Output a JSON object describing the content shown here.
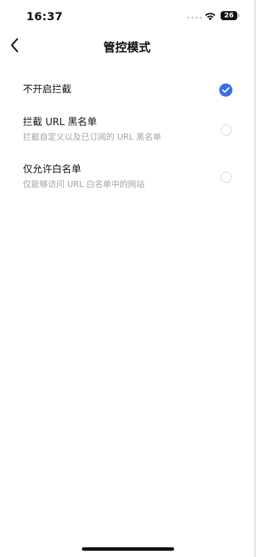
{
  "status_bar": {
    "time": "16:37",
    "battery_level": "26"
  },
  "nav": {
    "title": "管控模式"
  },
  "options": [
    {
      "title": "不开启拦截",
      "description": "",
      "selected": true
    },
    {
      "title": "拦截 URL 黑名单",
      "description": "拦截自定义以及已订阅的 URL 黑名单",
      "selected": false
    },
    {
      "title": "仅允许白名单",
      "description": "仅能够访问 URL 白名单中的网站",
      "selected": false
    }
  ],
  "colors": {
    "accent": "#3a6ee8",
    "secondary_text": "#a2a2a8"
  }
}
